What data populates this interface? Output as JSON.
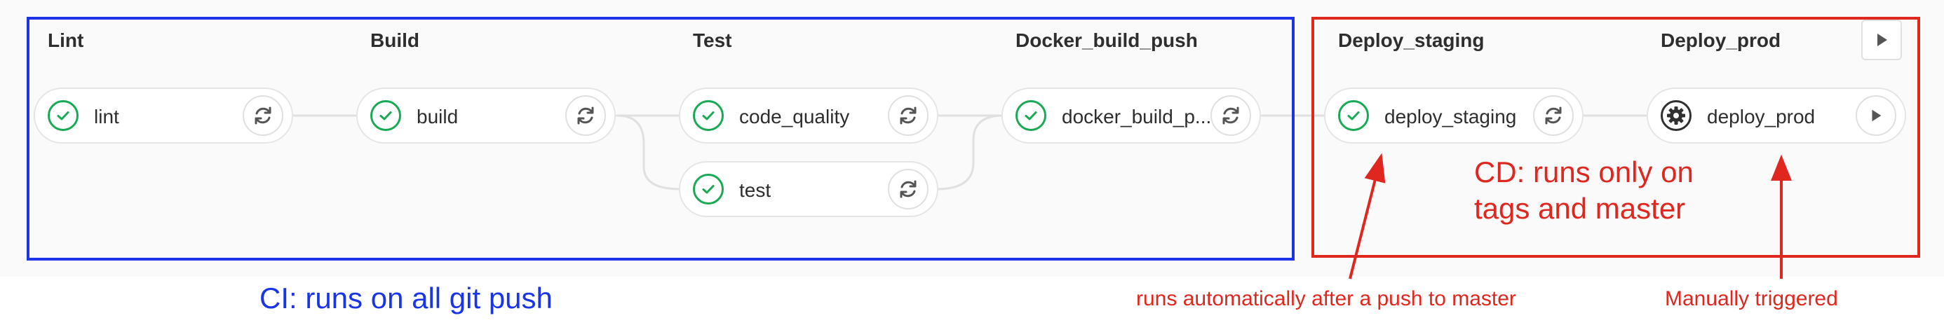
{
  "stages": [
    {
      "title": "Lint",
      "jobs": [
        {
          "name": "lint",
          "status": "success",
          "action": "retry"
        }
      ]
    },
    {
      "title": "Build",
      "jobs": [
        {
          "name": "build",
          "status": "success",
          "action": "retry"
        }
      ]
    },
    {
      "title": "Test",
      "jobs": [
        {
          "name": "code_quality",
          "status": "success",
          "action": "retry"
        },
        {
          "name": "test",
          "status": "success",
          "action": "retry"
        }
      ]
    },
    {
      "title": "Docker_build_push",
      "jobs": [
        {
          "name": "docker_build_p...",
          "status": "success",
          "action": "retry"
        }
      ]
    },
    {
      "title": "Deploy_staging",
      "jobs": [
        {
          "name": "deploy_staging",
          "status": "success",
          "action": "retry"
        }
      ]
    },
    {
      "title": "Deploy_prod",
      "jobs": [
        {
          "name": "deploy_prod",
          "status": "manual",
          "action": "play"
        }
      ]
    }
  ],
  "annotations": {
    "ci_label": "CI: runs on all git push",
    "cd_label_line1": "CD: runs only on",
    "cd_label_line2": "tags and master",
    "staging_note": "runs automatically after a push to master",
    "prod_note": "Manually triggered"
  },
  "colors": {
    "ci_blue": "#1a35e8",
    "cd_red": "#e0271f",
    "success_green": "#1aaa55"
  },
  "icons": {
    "success": "check-circle-icon",
    "manual": "gear-icon",
    "retry": "retry-icon",
    "play": "play-icon"
  }
}
